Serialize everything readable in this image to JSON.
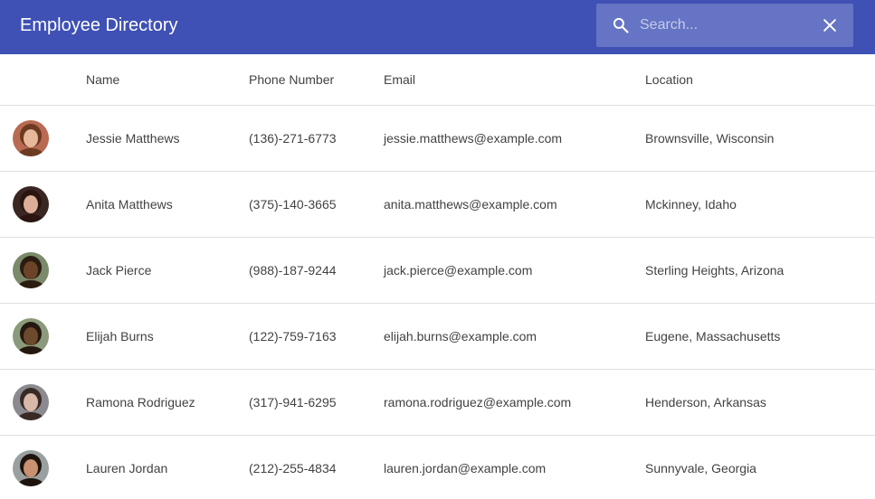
{
  "app": {
    "title": "Employee Directory"
  },
  "search": {
    "placeholder": "Search...",
    "value": ""
  },
  "icons": {
    "search": "search-icon",
    "clear": "close-icon"
  },
  "colors": {
    "appbar": "#3f51b5",
    "search_box": "#6574c4"
  },
  "table": {
    "headers": {
      "name": "Name",
      "phone": "Phone Number",
      "email": "Email",
      "location": "Location"
    },
    "rows": [
      {
        "name": "Jessie Matthews",
        "phone": "(136)-271-6773",
        "email": "jessie.matthews@example.com",
        "location": "Brownsville, Wisconsin",
        "avatar": {
          "bg": "#b86a52",
          "skin": "#e8b89a",
          "hair": "#6b3b22"
        }
      },
      {
        "name": "Anita Matthews",
        "phone": "(375)-140-3665",
        "email": "anita.matthews@example.com",
        "location": "Mckinney, Idaho",
        "avatar": {
          "bg": "#3a2622",
          "skin": "#dcae98",
          "hair": "#2a1510"
        }
      },
      {
        "name": "Jack Pierce",
        "phone": "(988)-187-9244",
        "email": "jack.pierce@example.com",
        "location": "Sterling Heights, Arizona",
        "avatar": {
          "bg": "#7a8a6a",
          "skin": "#6b4428",
          "hair": "#2b1c12"
        }
      },
      {
        "name": "Elijah Burns",
        "phone": "(122)-759-7163",
        "email": "elijah.burns@example.com",
        "location": "Eugene, Massachusetts",
        "avatar": {
          "bg": "#8a9a7a",
          "skin": "#6e4a2c",
          "hair": "#241810"
        }
      },
      {
        "name": "Ramona Rodriguez",
        "phone": "(317)-941-6295",
        "email": "ramona.rodriguez@example.com",
        "location": "Henderson, Arkansas",
        "avatar": {
          "bg": "#8a8a90",
          "skin": "#d8b8a8",
          "hair": "#3a2a26"
        }
      },
      {
        "name": "Lauren Jordan",
        "phone": "(212)-255-4834",
        "email": "lauren.jordan@example.com",
        "location": "Sunnyvale, Georgia",
        "avatar": {
          "bg": "#9aa0a0",
          "skin": "#c99072",
          "hair": "#1e140e"
        }
      }
    ]
  }
}
